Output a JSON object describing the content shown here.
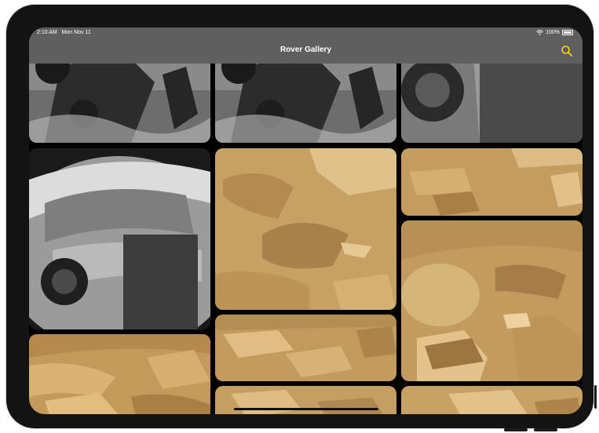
{
  "status_bar": {
    "time": "2:10 AM",
    "date": "Mon Nov 11",
    "battery": "100%",
    "wifi_icon": "wifi-icon",
    "battery_icon": "battery-icon"
  },
  "nav_bar": {
    "title": "Rover Gallery",
    "search_icon": "search-icon",
    "accent_color": "#ffd60a"
  },
  "gallery": {
    "photos": [
      {
        "tone": "grayscale",
        "subject": "rover-shadow-tracks"
      },
      {
        "tone": "grayscale",
        "subject": "rover-shadow-tracks"
      },
      {
        "tone": "grayscale",
        "subject": "rover-wheel-shadow"
      },
      {
        "tone": "grayscale",
        "subject": "fisheye-terrain-shadow"
      },
      {
        "tone": "color",
        "subject": "martian-rocks"
      },
      {
        "tone": "color",
        "subject": "martian-rocks"
      },
      {
        "tone": "color",
        "subject": "martian-rocks"
      },
      {
        "tone": "color",
        "subject": "martian-rocks"
      },
      {
        "tone": "color",
        "subject": "martian-rocks"
      },
      {
        "tone": "color",
        "subject": "martian-rocks"
      },
      {
        "tone": "color",
        "subject": "martian-rocks"
      }
    ]
  }
}
